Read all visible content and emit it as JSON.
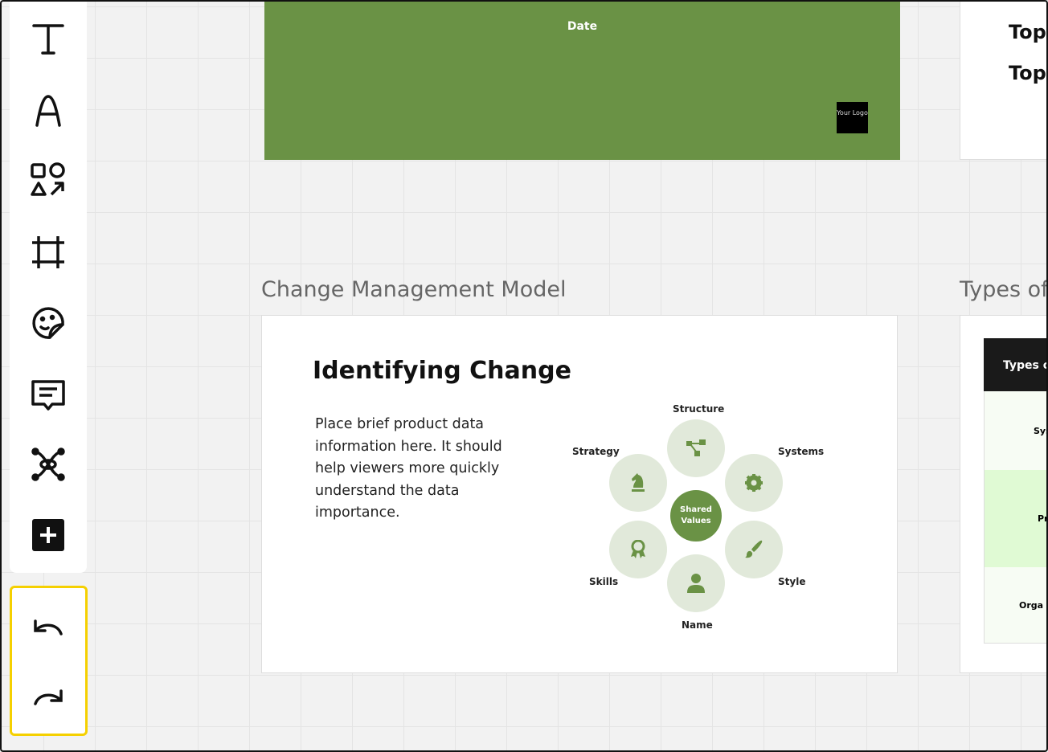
{
  "toolbar": {
    "tools": [
      {
        "name": "text-tool",
        "icon": "text-icon"
      },
      {
        "name": "font-tool",
        "icon": "letter-a-icon"
      },
      {
        "name": "shapes-tool",
        "icon": "shapes-icon"
      },
      {
        "name": "frame-tool",
        "icon": "frame-icon"
      },
      {
        "name": "sticker-tool",
        "icon": "sticker-icon"
      },
      {
        "name": "comment-tool",
        "icon": "comment-icon"
      },
      {
        "name": "mindmap-tool",
        "icon": "mindmap-icon"
      },
      {
        "name": "add-tool",
        "icon": "plus-icon"
      }
    ]
  },
  "history": {
    "undo_icon": "undo-icon",
    "redo_icon": "redo-icon",
    "highlight_color": "#f5d000"
  },
  "top_slide": {
    "date": "Date",
    "logo": "Your Logo",
    "color": "#6a9245"
  },
  "top_right_slide": {
    "lines": [
      "Top",
      "Top"
    ]
  },
  "frames": [
    {
      "title": "Change Management Model",
      "slide": {
        "heading": "Identifying Change",
        "body": "Place brief product data information here. It should help viewers more quickly understand the data importance.",
        "diagram": {
          "center": "Shared Values",
          "nodes": [
            {
              "label": "Structure",
              "icon": "hierarchy-icon"
            },
            {
              "label": "Systems",
              "icon": "gear-icon"
            },
            {
              "label": "Style",
              "icon": "paintbrush-icon"
            },
            {
              "label": "Name",
              "icon": "person-icon"
            },
            {
              "label": "Skills",
              "icon": "award-icon"
            },
            {
              "label": "Strategy",
              "icon": "chess-knight-icon"
            }
          ]
        }
      }
    },
    {
      "title": "Types of",
      "table": {
        "header": "Types o",
        "rows": [
          "Sys",
          "Pr",
          "Orga"
        ]
      }
    }
  ]
}
